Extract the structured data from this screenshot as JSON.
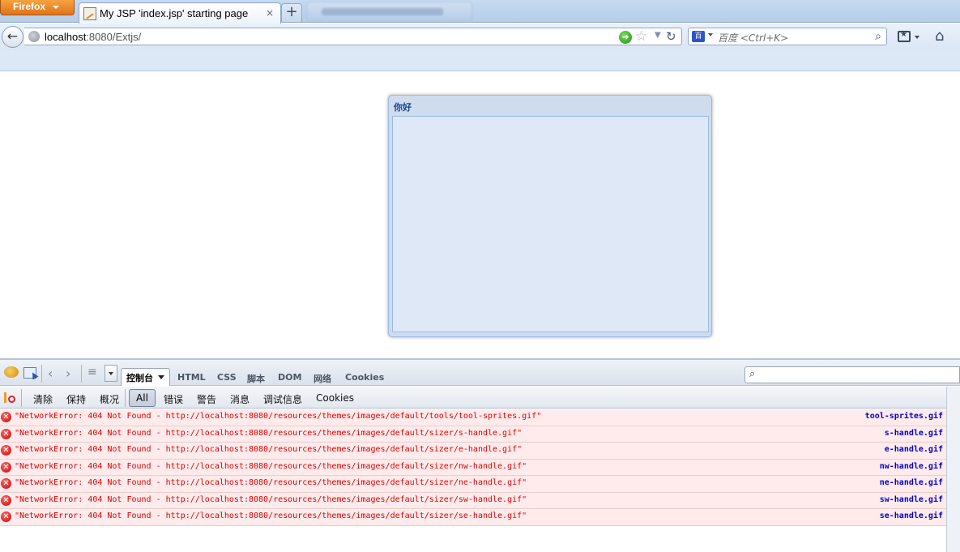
{
  "browser": {
    "menu_button": "Firefox",
    "active_tab_title": "My JSP 'index.jsp' starting page",
    "close_glyph": "×",
    "new_tab_glyph": "+",
    "url_host": "localhost",
    "url_rest": ":8080/Extjs/",
    "search_placeholder": "百度 <Ctrl+K>",
    "search_engine_label": "百"
  },
  "page": {
    "panel_title": "你好"
  },
  "firebug": {
    "panel_menu_label": "控制台",
    "tabs": [
      "HTML",
      "CSS",
      "脚本",
      "DOM",
      "网络",
      "Cookies"
    ],
    "console_buttons": [
      "清除",
      "保持",
      "概况"
    ],
    "filters": [
      "All",
      "错误",
      "警告",
      "消息",
      "调试信息",
      "Cookies"
    ],
    "active_filter": "All",
    "errors": [
      {
        "message": "\"NetworkError: 404 Not Found - http://localhost:8080/resources/themes/images/default/tools/tool-sprites.gif\"",
        "source": "tool-sprites.gif"
      },
      {
        "message": "\"NetworkError: 404 Not Found - http://localhost:8080/resources/themes/images/default/sizer/s-handle.gif\"",
        "source": "s-handle.gif"
      },
      {
        "message": "\"NetworkError: 404 Not Found - http://localhost:8080/resources/themes/images/default/sizer/e-handle.gif\"",
        "source": "e-handle.gif"
      },
      {
        "message": "\"NetworkError: 404 Not Found - http://localhost:8080/resources/themes/images/default/sizer/nw-handle.gif\"",
        "source": "nw-handle.gif"
      },
      {
        "message": "\"NetworkError: 404 Not Found - http://localhost:8080/resources/themes/images/default/sizer/ne-handle.gif\"",
        "source": "ne-handle.gif"
      },
      {
        "message": "\"NetworkError: 404 Not Found - http://localhost:8080/resources/themes/images/default/sizer/sw-handle.gif\"",
        "source": "sw-handle.gif"
      },
      {
        "message": "\"NetworkError: 404 Not Found - http://localhost:8080/resources/themes/images/default/sizer/se-handle.gif\"",
        "source": "se-handle.gif"
      }
    ]
  },
  "colors": {
    "error_text": "#e00000",
    "source_link": "#0000d0",
    "error_row_bg": "#ffebeb",
    "ext_panel_title": "#15428b"
  },
  "icons": [
    "firefox-menu",
    "back-arrow-icon",
    "globe-icon",
    "go-icon",
    "star-icon",
    "reload-icon",
    "search-icon",
    "bookmarks-icon",
    "home-icon",
    "firebug-icon",
    "inspect-icon",
    "error-icon"
  ]
}
